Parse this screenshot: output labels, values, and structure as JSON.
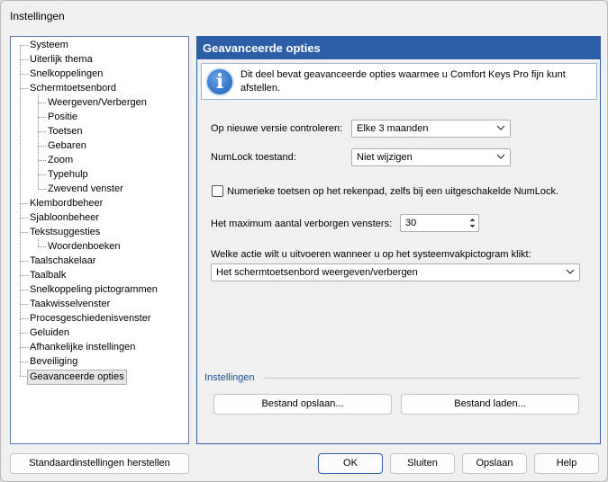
{
  "window": {
    "title": "Instellingen"
  },
  "tree": {
    "items": [
      {
        "label": "Systeem",
        "level": 0
      },
      {
        "label": "Uiterlijk thema",
        "level": 0
      },
      {
        "label": "Snelkoppelingen",
        "level": 0
      },
      {
        "label": "Schermtoetsenbord",
        "level": 0
      },
      {
        "label": "Weergeven/Verbergen",
        "level": 1
      },
      {
        "label": "Positie",
        "level": 1
      },
      {
        "label": "Toetsen",
        "level": 1
      },
      {
        "label": "Gebaren",
        "level": 1
      },
      {
        "label": "Zoom",
        "level": 1
      },
      {
        "label": "Typehulp",
        "level": 1
      },
      {
        "label": "Zwevend venster",
        "level": 1
      },
      {
        "label": "Klembordbeheer",
        "level": 0
      },
      {
        "label": "Sjabloonbeheer",
        "level": 0
      },
      {
        "label": "Tekstsuggesties",
        "level": 0
      },
      {
        "label": "Woordenboeken",
        "level": 1
      },
      {
        "label": "Taalschakelaar",
        "level": 0
      },
      {
        "label": "Taalbalk",
        "level": 0
      },
      {
        "label": "Snelkoppeling pictogrammen",
        "level": 0
      },
      {
        "label": "Taakwisselvenster",
        "level": 0
      },
      {
        "label": "Procesgeschiedenisvenster",
        "level": 0
      },
      {
        "label": "Geluiden",
        "level": 0
      },
      {
        "label": "Afhankelijke instellingen",
        "level": 0
      },
      {
        "label": "Beveiliging",
        "level": 0
      },
      {
        "label": "Geavanceerde opties",
        "level": 0,
        "selected": true
      }
    ]
  },
  "panel": {
    "title": "Geavanceerde opties",
    "info_text": "Dit deel bevat geavanceerde opties waarmee u Comfort Keys Pro fijn kunt afstellen.",
    "info_icon": "info-icon",
    "version_check": {
      "label": "Op nieuwe versie controleren:",
      "value": "Elke 3 maanden"
    },
    "numlock": {
      "label": "NumLock toestand:",
      "value": "Niet wijzigen"
    },
    "numeric_keys": {
      "label": "Numerieke toetsen op het rekenpad, zelfs bij een uitgeschakelde NumLock.",
      "checked": false
    },
    "max_hidden": {
      "label": "Het maximum aantal verborgen vensters:",
      "value": "30"
    },
    "tray_action": {
      "label": "Welke actie wilt u uitvoeren wanneer u op het systeemvakpictogram klikt:",
      "value": "Het schermtoetsenbord weergeven/verbergen"
    },
    "settings_group": {
      "label": "Instellingen",
      "save_label": "Bestand opslaan...",
      "load_label": "Bestand laden..."
    }
  },
  "footer": {
    "restore_label": "Standaardinstellingen herstellen",
    "ok_label": "OK",
    "close_label": "Sluiten",
    "save_label": "Opslaan",
    "help_label": "Help"
  },
  "colors": {
    "header_bg": "#2c5ea8",
    "group_label": "#1d4f91"
  }
}
